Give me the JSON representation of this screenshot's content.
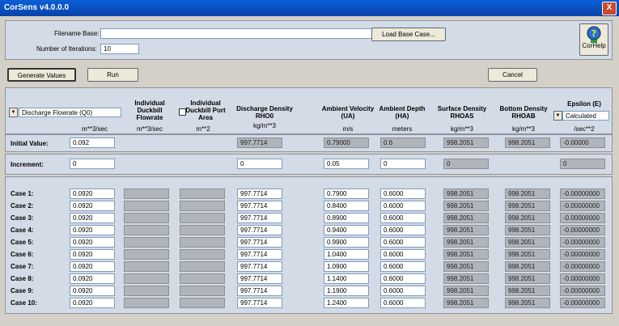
{
  "window": {
    "title": "CorSens v4.0.0.0",
    "close_label": "X"
  },
  "top": {
    "filename_label": "Filename Base:",
    "filename_value": "",
    "load_button": "Load Base Case...",
    "iterations_label": "Number of Iterations:",
    "iterations_value": "10",
    "help_label": "CorHelp"
  },
  "actions": {
    "generate": "Generate Values",
    "run": "Run",
    "cancel": "Cancel"
  },
  "columns": {
    "c0": {
      "dropdown": "Discharge Flowrate (Q0)",
      "unit": "m**3/sec"
    },
    "c1": {
      "header": "Individual Duckbill Flowrate",
      "unit": "m**3/sec"
    },
    "c2": {
      "header": "Individual Duckbill Port Area",
      "unit": "m**2"
    },
    "c3": {
      "header": "Discharge Density RHO0",
      "unit": "kg/m**3"
    },
    "c4": {
      "header": "Ambient Velocity (UA)",
      "unit": "m/s"
    },
    "c5": {
      "header": "Ambient Depth (HA)",
      "unit": "meters"
    },
    "c6": {
      "header": "Surface Density RHOAS",
      "unit": "kg/m**3"
    },
    "c7": {
      "header": "Bottom Density RHOAB",
      "unit": "kg/m**3"
    },
    "c8": {
      "header": "Epsilon (E)",
      "dropdown": "Calculated",
      "unit": "/sec**2"
    }
  },
  "initial": {
    "label": "Initial Value:",
    "values": [
      "0.092",
      "",
      "",
      "997.7714",
      "0.79000",
      "0.6",
      "998.2051",
      "998.2051",
      "-0.00000"
    ]
  },
  "increment": {
    "label": "Increment:",
    "values": [
      "0",
      "",
      "",
      "0",
      "0.05",
      "0",
      "0",
      "",
      "0"
    ]
  },
  "cases": [
    {
      "label": "Case 1:",
      "values": [
        "0.0920",
        "",
        "",
        "997.7714",
        "0.7900",
        "0.6000",
        "998.2051",
        "998.2051",
        "-0.00000000"
      ]
    },
    {
      "label": "Case 2:",
      "values": [
        "0.0920",
        "",
        "",
        "997.7714",
        "0.8400",
        "0.6000",
        "998.2051",
        "998.2051",
        "-0.00000000"
      ]
    },
    {
      "label": "Case 3:",
      "values": [
        "0.0920",
        "",
        "",
        "997.7714",
        "0.8900",
        "0.6000",
        "998.2051",
        "998.2051",
        "-0.00000000"
      ]
    },
    {
      "label": "Case 4:",
      "values": [
        "0.0920",
        "",
        "",
        "997.7714",
        "0.9400",
        "0.6000",
        "998.2051",
        "998.2051",
        "-0.00000000"
      ]
    },
    {
      "label": "Case 5:",
      "values": [
        "0.0920",
        "",
        "",
        "997.7714",
        "0.9900",
        "0.6000",
        "998.2051",
        "998.2051",
        "-0.00000000"
      ]
    },
    {
      "label": "Case 6:",
      "values": [
        "0.0920",
        "",
        "",
        "997.7714",
        "1.0400",
        "0.6000",
        "998.2051",
        "998.2051",
        "-0.00000000"
      ]
    },
    {
      "label": "Case 7:",
      "values": [
        "0.0920",
        "",
        "",
        "997.7714",
        "1.0900",
        "0.6000",
        "998.2051",
        "998.2051",
        "-0.00000000"
      ]
    },
    {
      "label": "Case 8:",
      "values": [
        "0.0920",
        "",
        "",
        "997.7714",
        "1.1400",
        "0.6000",
        "998.2051",
        "998.2051",
        "-0.00000000"
      ]
    },
    {
      "label": "Case 9:",
      "values": [
        "0.0920",
        "",
        "",
        "997.7714",
        "1.1900",
        "0.6000",
        "998.2051",
        "998.2051",
        "-0.00000000"
      ]
    },
    {
      "label": "Case 10:",
      "values": [
        "0.0920",
        "",
        "",
        "997.7714",
        "1.2400",
        "0.6000",
        "998.2051",
        "998.2051",
        "-0.00000000"
      ]
    }
  ]
}
